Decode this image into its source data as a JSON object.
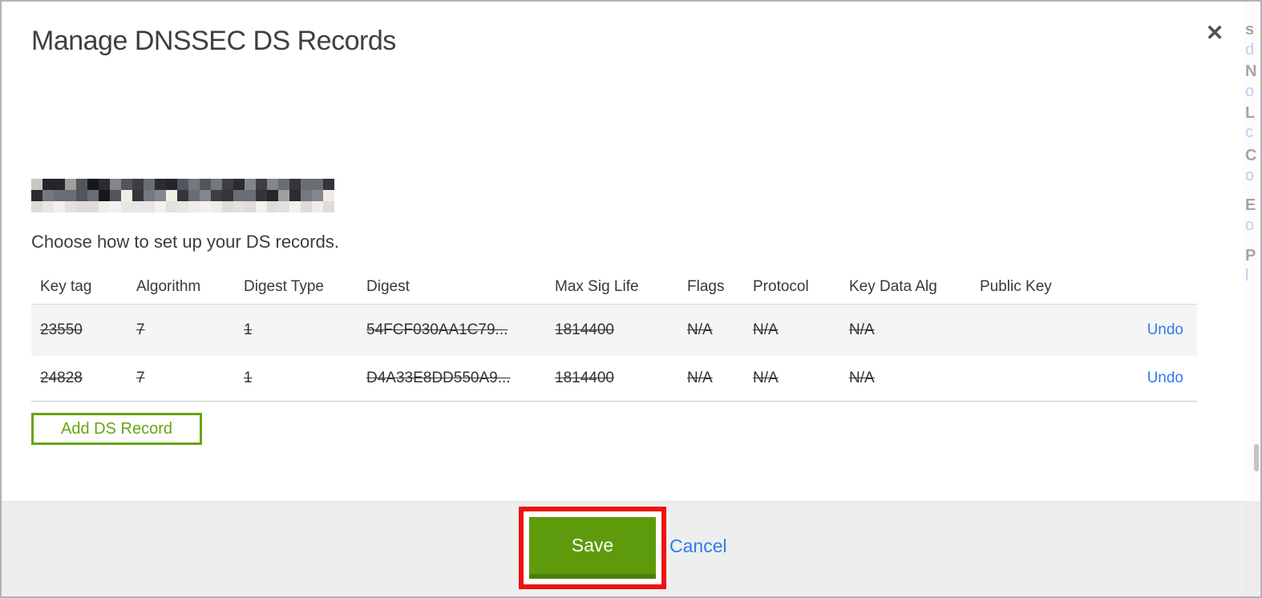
{
  "modal": {
    "title": "Manage DNSSEC DS Records",
    "close_icon": "✕",
    "subtitle": "Choose how to set up your DS records.",
    "table": {
      "headers": [
        "Key tag",
        "Algorithm",
        "Digest Type",
        "Digest",
        "Max Sig Life",
        "Flags",
        "Protocol",
        "Key Data Alg",
        "Public Key"
      ],
      "rows": [
        {
          "key_tag": "23550",
          "algorithm": "7",
          "digest_type": "1",
          "digest": "54FCF030AA1C79...",
          "max_sig_life": "1814400",
          "flags": "N/A",
          "protocol": "N/A",
          "key_data_alg": "N/A",
          "public_key": "",
          "action": "Undo",
          "state": "marked-for-deletion"
        },
        {
          "key_tag": "24828",
          "algorithm": "7",
          "digest_type": "1",
          "digest": "D4A33E8DD550A9...",
          "max_sig_life": "1814400",
          "flags": "N/A",
          "protocol": "N/A",
          "key_data_alg": "N/A",
          "public_key": "",
          "action": "Undo",
          "state": "marked-for-deletion"
        }
      ]
    },
    "add_ds_record_label": "Add DS Record",
    "footer": {
      "save_label": "Save",
      "cancel_label": "Cancel"
    }
  },
  "annotation": {
    "shape": "red-box-highlight",
    "target": "save-button",
    "color": "#ee1111"
  },
  "background_page": {
    "fragments": [
      "s",
      "d",
      "N",
      "o",
      "L",
      "c",
      "C",
      "o",
      "E",
      "o",
      "P",
      "l"
    ]
  },
  "colors": {
    "save_green": "#5d9b0c",
    "outline_green": "#67a315",
    "link_blue": "#2f7bef",
    "annotation_red": "#ee1111",
    "footer_gray": "#eeeeee",
    "row_stripe": "#f5f5f5"
  }
}
